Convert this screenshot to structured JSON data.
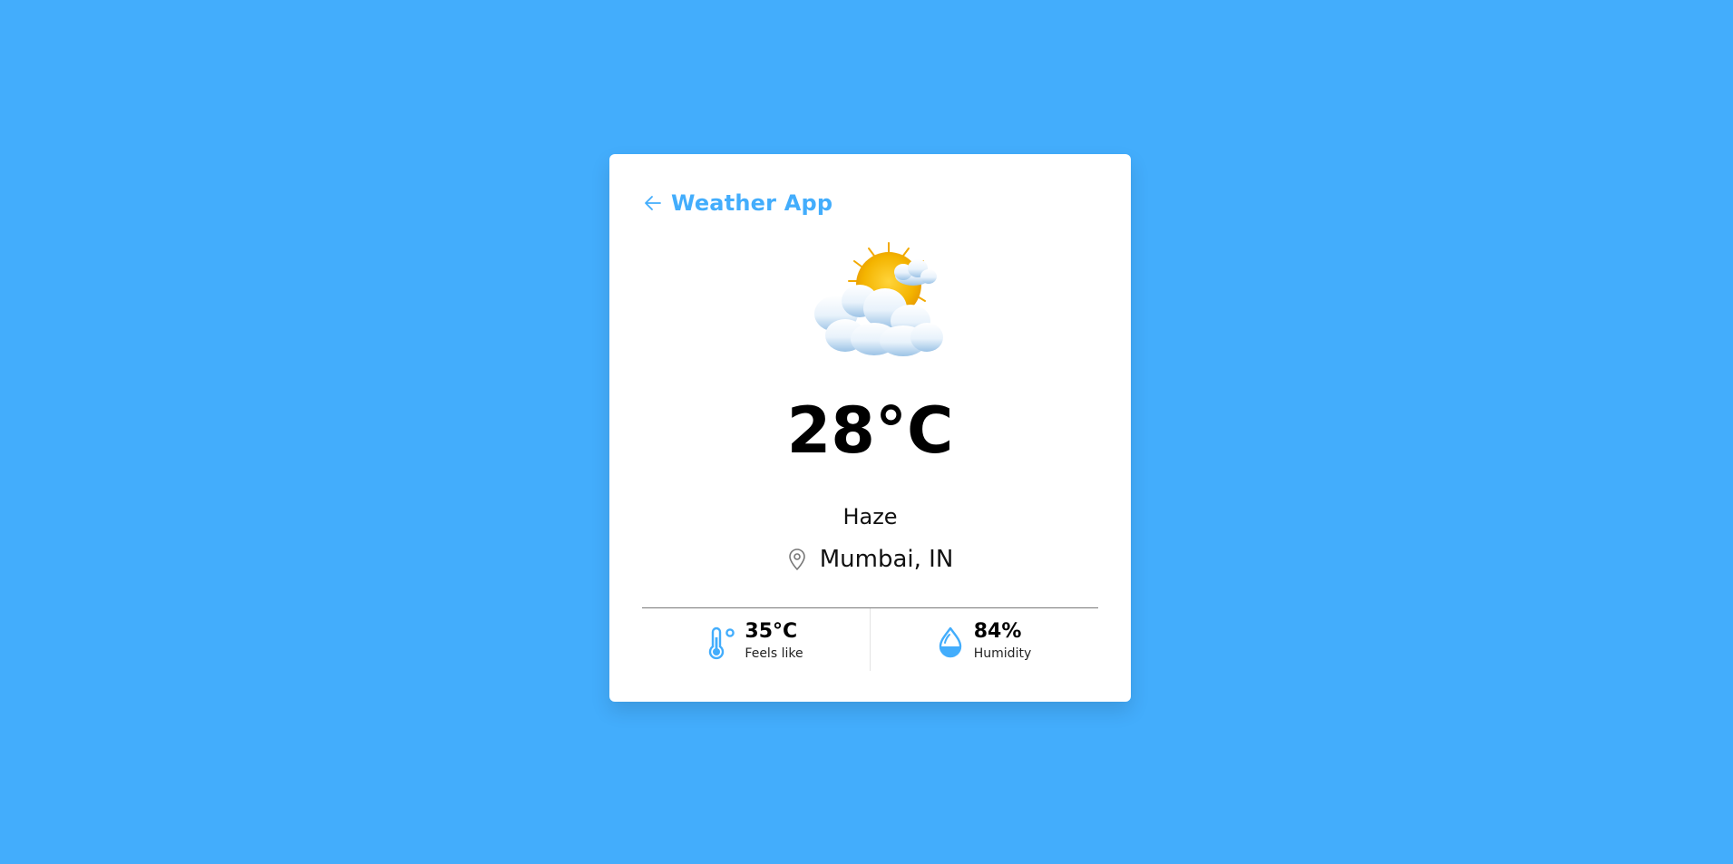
{
  "app": {
    "title": "Weather App",
    "back_icon": "arrow-left-icon",
    "accent_color": "#43adfc",
    "background_color": "#43adfc"
  },
  "weather": {
    "icon": "sun-behind-clouds-icon",
    "temperature": "28°C",
    "condition": "Haze",
    "location_icon": "map-pin-icon",
    "location": "Mumbai, IN"
  },
  "stats": [
    {
      "icon": "thermometer-icon",
      "value": "35°C",
      "label": "Feels like"
    },
    {
      "icon": "water-drop-icon",
      "value": "84%",
      "label": "Humidity"
    }
  ]
}
